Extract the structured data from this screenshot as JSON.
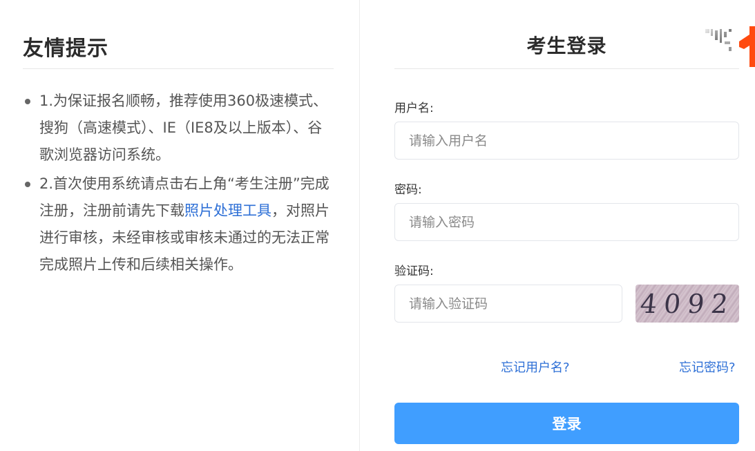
{
  "tips": {
    "title": "友情提示",
    "item1": "1.为保证报名顺畅，推荐使用360极速模式、搜狗（高速模式）、IE（IE8及以上版本）、谷歌浏览器访问系统。",
    "item2_pre": "2.首次使用系统请点击右上角“考生注册”完成注册，注册前请先下载",
    "item2_link": "照片处理工具",
    "item2_post": "，对照片进行审核，未经审核或审核未通过的无法正常完成照片上传和后续相关操作。"
  },
  "login": {
    "title": "考生登录",
    "username_label": "用户名:",
    "username_placeholder": "请输入用户名",
    "username_value": "",
    "password_label": "密码:",
    "password_placeholder": "请输入密码",
    "password_value": "",
    "captcha_label": "验证码:",
    "captcha_placeholder": "请输入验证码",
    "captcha_value": "",
    "captcha_text": "4092",
    "forgot_username": "忘记用户名?",
    "forgot_password": "忘记密码?",
    "submit": "登录"
  },
  "colors": {
    "accent": "#409eff",
    "link": "#2d6fd6",
    "corner_accent": "#ff4a0f"
  },
  "icons": {
    "corner": "qr-code-icon"
  }
}
